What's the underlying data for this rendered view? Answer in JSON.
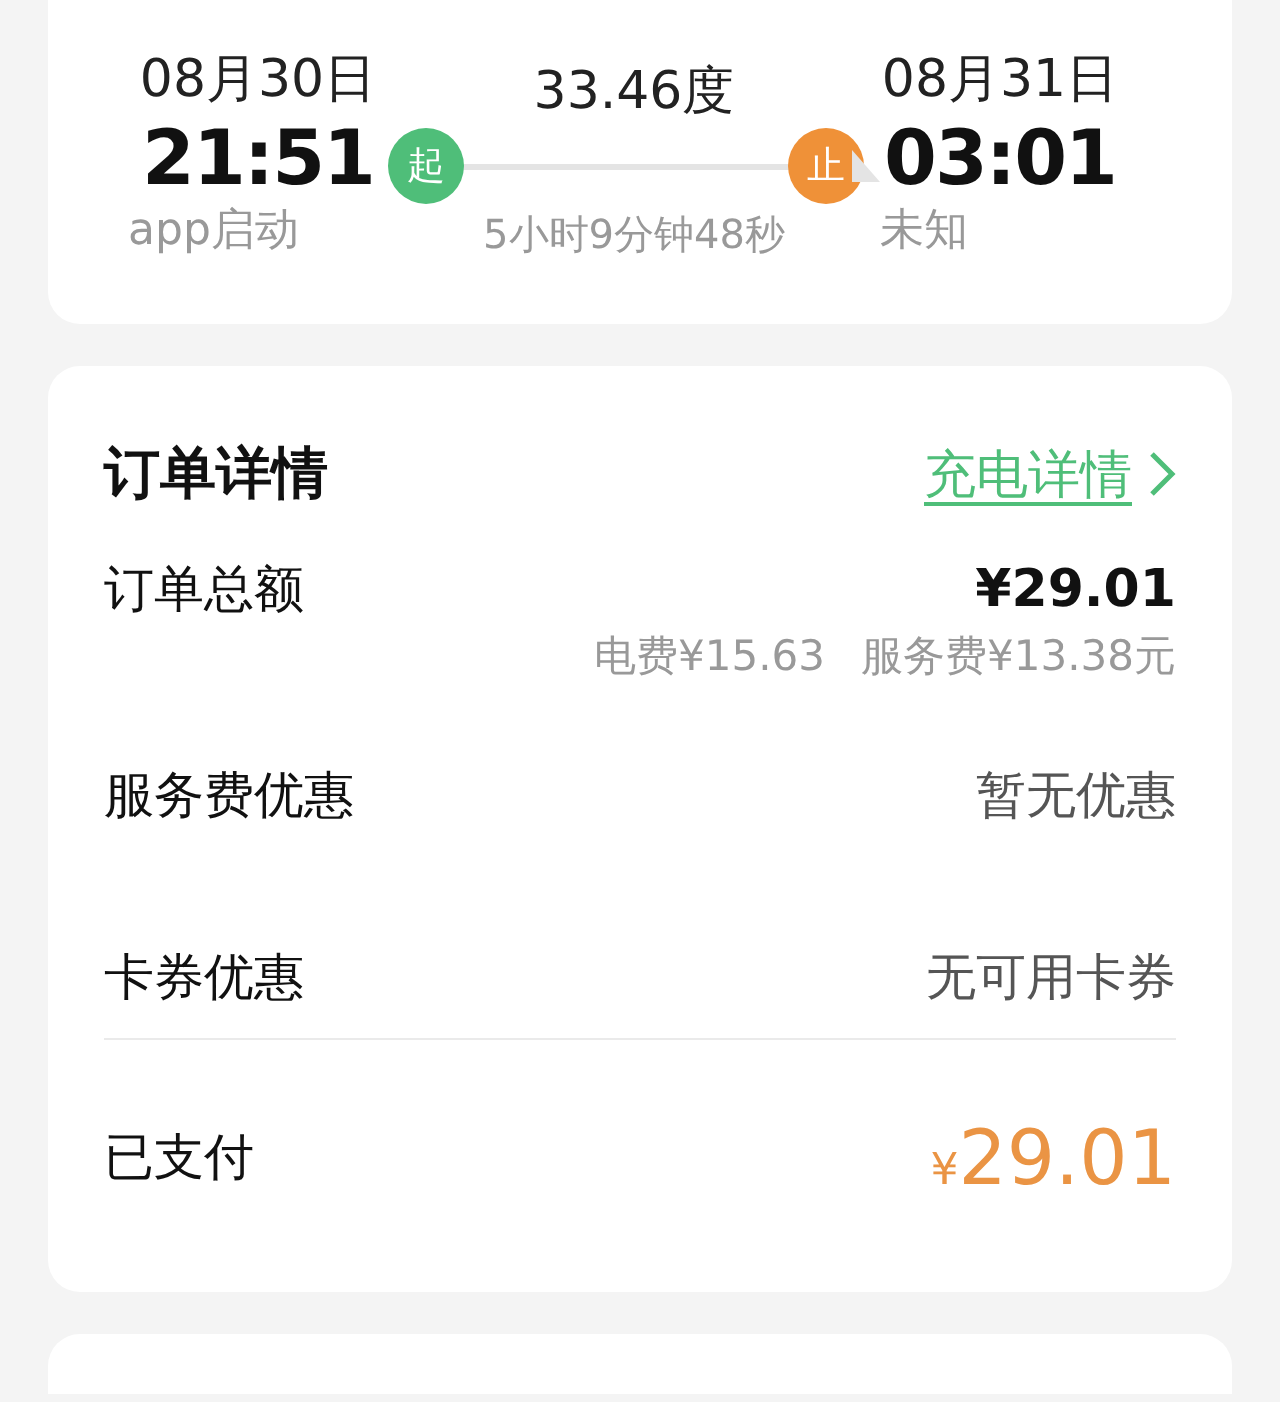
{
  "trip": {
    "start": {
      "date": "08月30日",
      "time": "21:51",
      "source": "app启动",
      "badge": "起"
    },
    "end": {
      "date": "08月31日",
      "time": "03:01",
      "source": "未知",
      "badge": "止"
    },
    "energy": "33.46度",
    "duration": "5小时9分钟48秒"
  },
  "order": {
    "title": "订单详情",
    "link": "充电详情",
    "rows": [
      {
        "kind": "total",
        "label": "订单总额",
        "value": "¥29.01",
        "details": [
          "电费¥15.63",
          "服务费¥13.38元"
        ]
      },
      {
        "kind": "plain",
        "label": "服务费优惠",
        "value": "暂无优惠"
      },
      {
        "kind": "plain",
        "label": "卡券优惠",
        "value": "无可用卡券"
      }
    ],
    "paid": {
      "label": "已支付",
      "currency": "¥",
      "amount": "29.01"
    }
  }
}
